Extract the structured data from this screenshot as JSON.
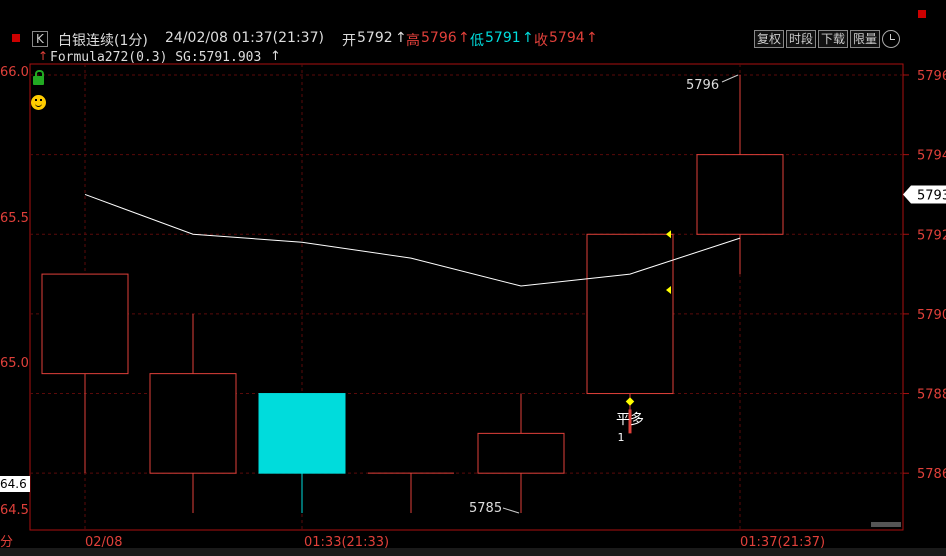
{
  "header": {
    "k_badge": "K",
    "title": "白银连续(1分)",
    "datetime": "24/02/08 01:37(21:37)",
    "open_label": "开",
    "open_value": "5792",
    "high_label": "高",
    "high_value": "5796",
    "low_label": "低",
    "low_value": "5791",
    "close_label": "收",
    "close_value": "5794",
    "arrow": "↑",
    "formula_line": "Formula272(0.3) SG:5791.903",
    "buttons": [
      "复权",
      "时段",
      "下载",
      "限量"
    ]
  },
  "colors": {
    "up": "#e0403a",
    "down": "#00dcdc",
    "grid": "#5a0a0a",
    "axis": "#aa1010",
    "sg_line": "#ffffff",
    "signal": "#ffff00",
    "price_box": "#ffffff"
  },
  "chart_data": {
    "type": "candlestick",
    "x": [
      "t1",
      "t2",
      "t3",
      "t4",
      "t5",
      "t6",
      "t7"
    ],
    "open": [
      5788.5,
      5786.0,
      5788.0,
      5786.0,
      5786.0,
      5788.0,
      5792.0
    ],
    "high": [
      5788.5,
      5790.0,
      5788.0,
      5786.0,
      5788.0,
      5792.0,
      5796.0
    ],
    "low": [
      5786.0,
      5785.0,
      5785.0,
      5785.0,
      5785.0,
      5787.5,
      5791.0
    ],
    "close": [
      5791.0,
      5788.5,
      5786.0,
      5786.0,
      5787.0,
      5792.0,
      5794.0
    ],
    "sg_values": [
      5793.0,
      5792.0,
      5791.8,
      5791.4,
      5790.7,
      5791.0,
      5791.903
    ],
    "y_ticks_right": [
      "5796",
      "5794",
      "5793",
      "5792",
      "5790",
      "5788",
      "5786"
    ],
    "y_ticks_left": [
      "66.0",
      "65.5",
      "65.0",
      "64.6",
      "64.5"
    ],
    "x_labels": [
      "02/08",
      "01:33(21:33)",
      "01:37(21:37)"
    ],
    "annotations": {
      "high_label": "5796",
      "low_label": "5785",
      "signal_text": "平多",
      "signal_sub": "1",
      "current_price": "5793"
    },
    "y_range": [
      5784.5,
      5796.5
    ]
  }
}
